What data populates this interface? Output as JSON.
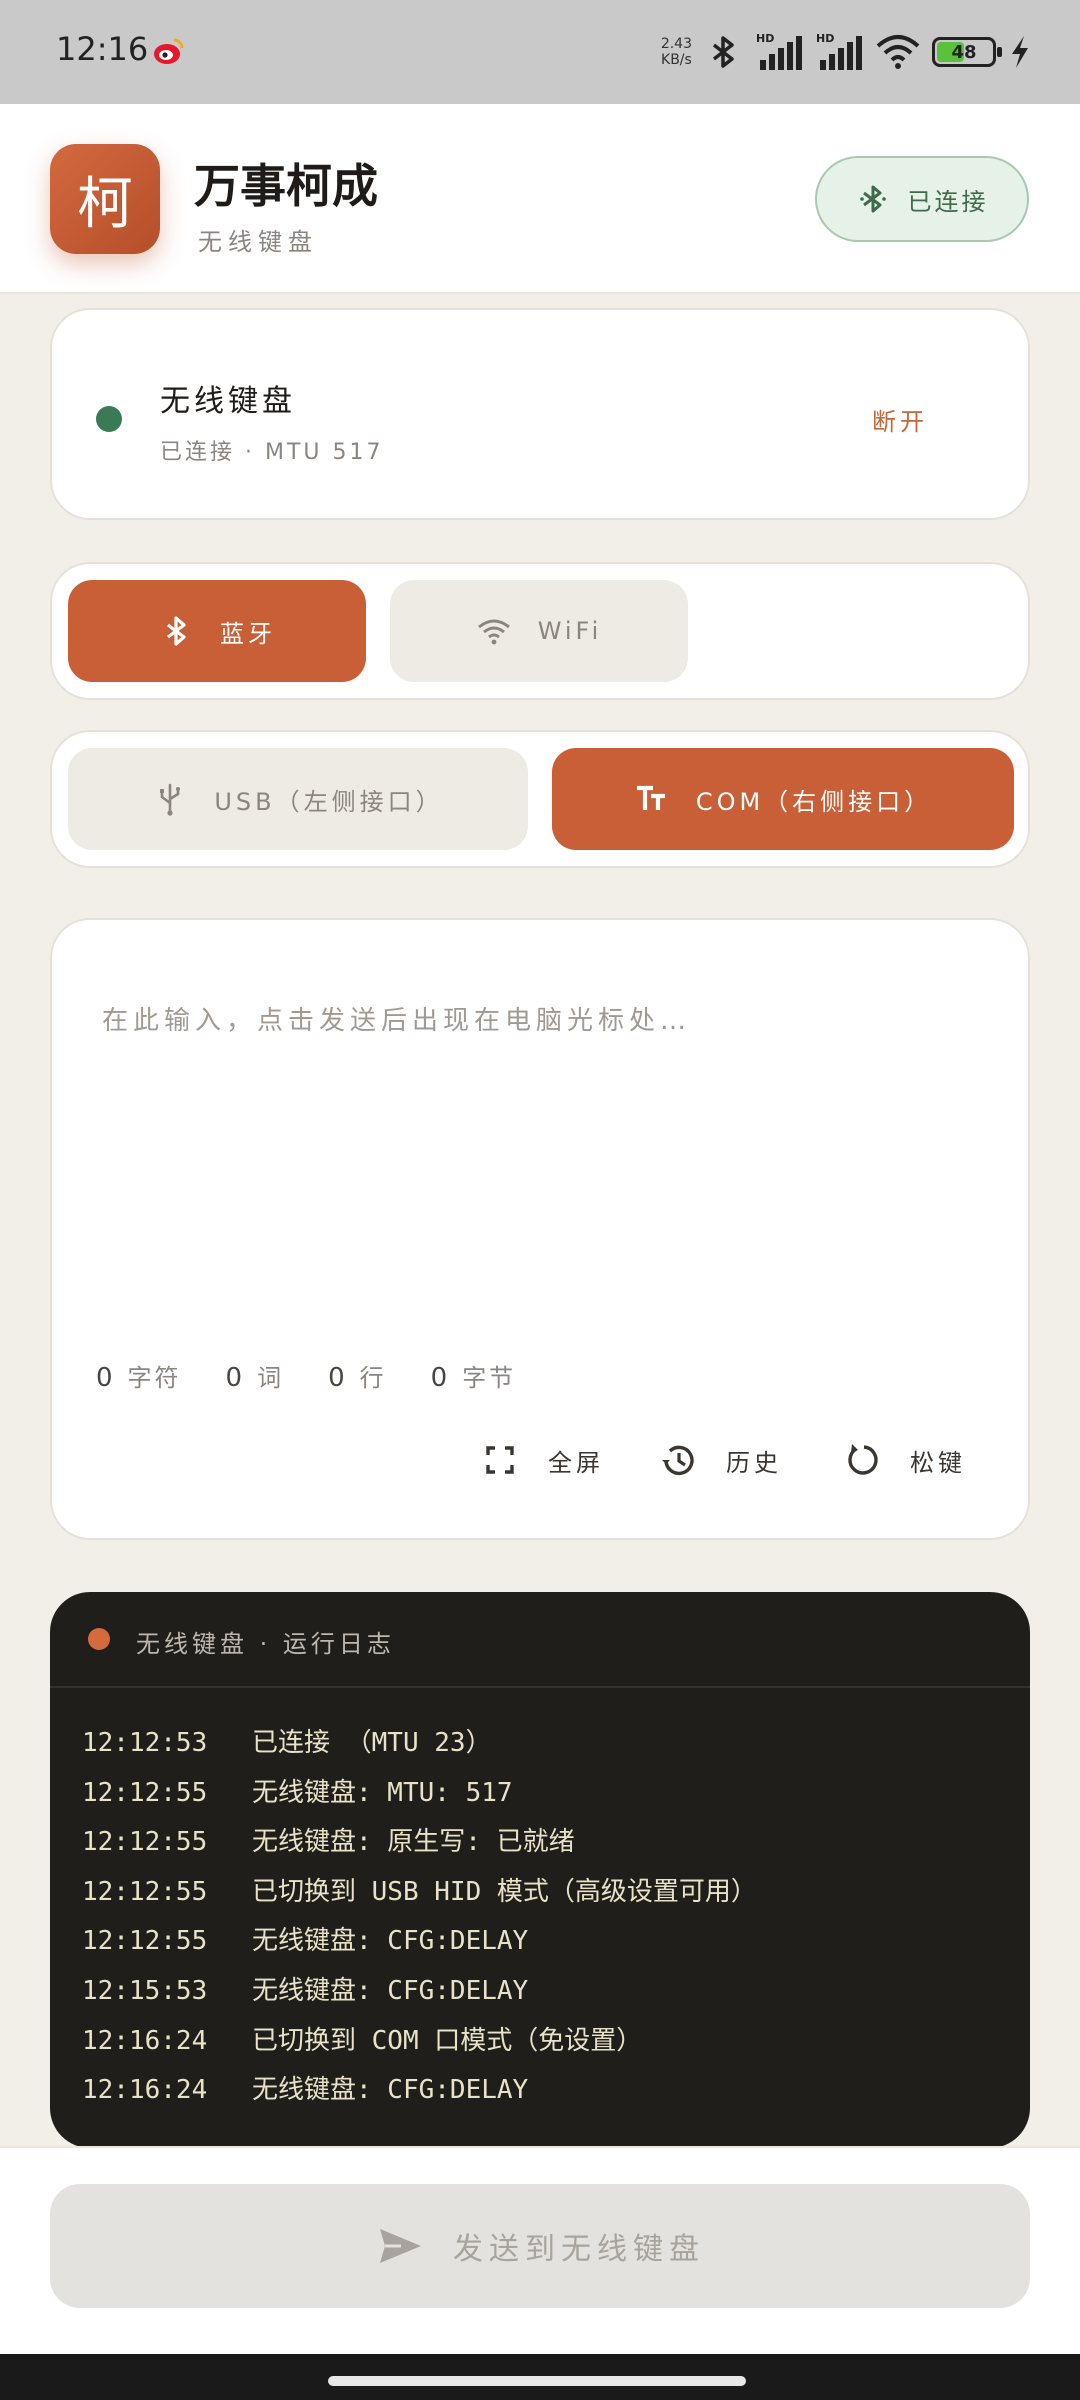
{
  "status_bar": {
    "time": "12:16",
    "net_speed_value": "2.43",
    "net_speed_unit": "KB/s",
    "battery": "48",
    "icons": [
      "weibo-icon",
      "bluetooth-icon",
      "signal-hd-icon",
      "signal-hd-icon",
      "wifi-icon",
      "battery-icon",
      "charging-icon"
    ]
  },
  "header": {
    "app_icon_char": "柯",
    "title": "万事柯成",
    "subtitle": "无线键盘",
    "connection_label": "已连接"
  },
  "device": {
    "name": "无线键盘",
    "status": "已连接 · MTU 517",
    "disconnect_label": "断开"
  },
  "modes": {
    "bluetooth_label": "蓝牙",
    "wifi_label": "WiFi",
    "selected": "bluetooth"
  },
  "ports": {
    "usb_label": "USB（左侧接口）",
    "com_label": "COM（右侧接口）",
    "selected": "com"
  },
  "editor": {
    "placeholder": "在此输入，点击发送后出现在电脑光标处…",
    "counts": [
      {
        "value": "0",
        "unit": "字符"
      },
      {
        "value": "0",
        "unit": "词"
      },
      {
        "value": "0",
        "unit": "行"
      },
      {
        "value": "0",
        "unit": "字节"
      }
    ],
    "tools": {
      "fullscreen": "全屏",
      "history": "历史",
      "release_keys": "松键"
    }
  },
  "log": {
    "title": "无线键盘 · 运行日志",
    "entries": [
      {
        "time": "12:12:53",
        "message": "已连接 （MTU 23）"
      },
      {
        "time": "12:12:55",
        "message": "无线键盘: MTU: 517"
      },
      {
        "time": "12:12:55",
        "message": "无线键盘: 原生写: 已就绪"
      },
      {
        "time": "12:12:55",
        "message": "已切换到 USB HID 模式（高级设置可用）"
      },
      {
        "time": "12:12:55",
        "message": "无线键盘: CFG:DELAY"
      },
      {
        "time": "12:15:53",
        "message": "无线键盘: CFG:DELAY"
      },
      {
        "time": "12:16:24",
        "message": "已切换到 COM 口模式（免设置）"
      },
      {
        "time": "12:16:24",
        "message": "无线键盘: CFG:DELAY"
      }
    ]
  },
  "send_button_label": "发送到无线键盘",
  "colors": {
    "accent": "#c85f36",
    "connected_green": "#3b7a57",
    "background": "#f2efe9",
    "log_background": "#1f1e1b"
  }
}
